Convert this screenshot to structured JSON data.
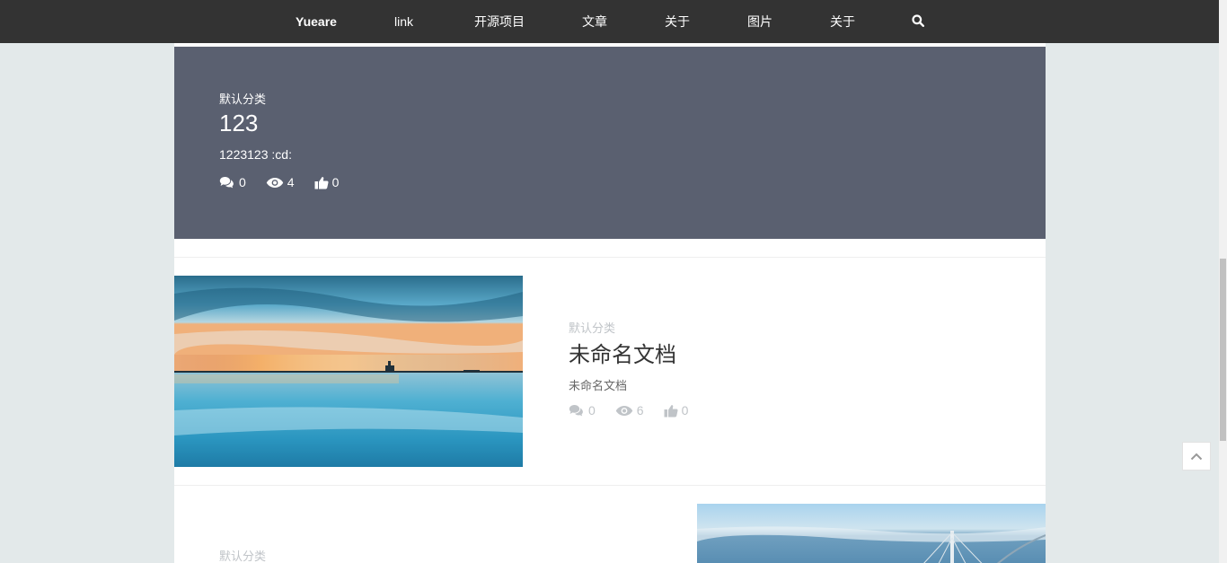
{
  "nav": {
    "items": [
      {
        "label": "Yueare",
        "bold": true
      },
      {
        "label": "link"
      },
      {
        "label": "开源项目"
      },
      {
        "label": "文章"
      },
      {
        "label": "关于"
      },
      {
        "label": "图片"
      },
      {
        "label": "关于"
      }
    ],
    "search_icon": "search-icon"
  },
  "featured": {
    "category": "默认分类",
    "title": "123",
    "description": "1223123 :cd:",
    "comments": "0",
    "views": "4",
    "likes": "0"
  },
  "posts": [
    {
      "category": "默认分类",
      "title": "未命名文档",
      "description": "未命名文档",
      "comments": "0",
      "views": "6",
      "likes": "0"
    },
    {
      "category": "默认分类"
    }
  ],
  "colors": {
    "nav_bg": "#333333",
    "featured_bg": "#5a6070",
    "page_bg": "#e3e9ea",
    "meta_gray": "#c0c4c8"
  }
}
